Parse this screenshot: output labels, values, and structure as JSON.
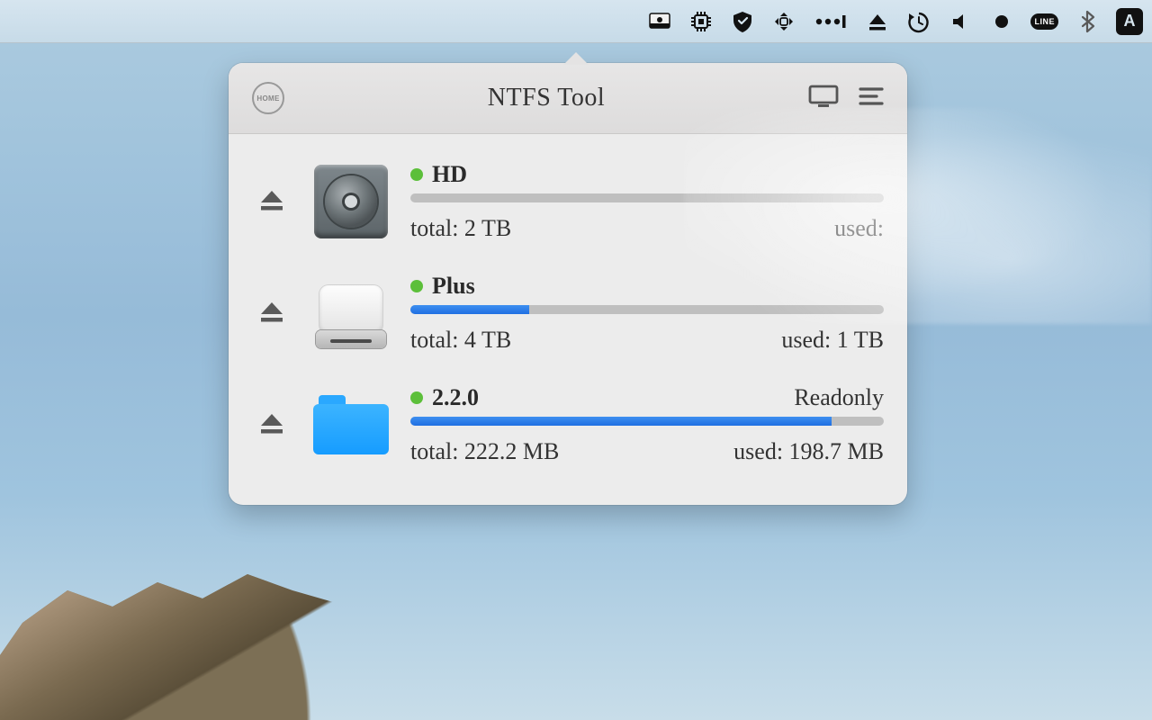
{
  "app": {
    "title": "NTFS Tool"
  },
  "header": {
    "home_label": "HOME"
  },
  "drives": [
    {
      "name": "HD",
      "icon": "internal-hdd",
      "status": "ok",
      "readonly_label": "",
      "total_label": "total: 2 TB",
      "used_label": "used:",
      "used_pct": 0
    },
    {
      "name": "Plus",
      "icon": "external-drive",
      "status": "ok",
      "readonly_label": "",
      "total_label": "total: 4 TB",
      "used_label": "used: 1 TB",
      "used_pct": 25
    },
    {
      "name": "2.2.0",
      "icon": "folder",
      "status": "ok",
      "readonly_label": "Readonly",
      "total_label": "total: 222.2 MB",
      "used_label": "used: 198.7 MB",
      "used_pct": 89
    }
  ],
  "menubar": {
    "icons": [
      "drive-icon",
      "chip-icon",
      "shield-icon",
      "android-icon",
      "password-icon",
      "eject-icon",
      "timemachine-icon",
      "volume-icon",
      "record-icon",
      "line-app-icon",
      "bluetooth-icon",
      "letter-a-icon"
    ],
    "line_label": "LINE"
  }
}
